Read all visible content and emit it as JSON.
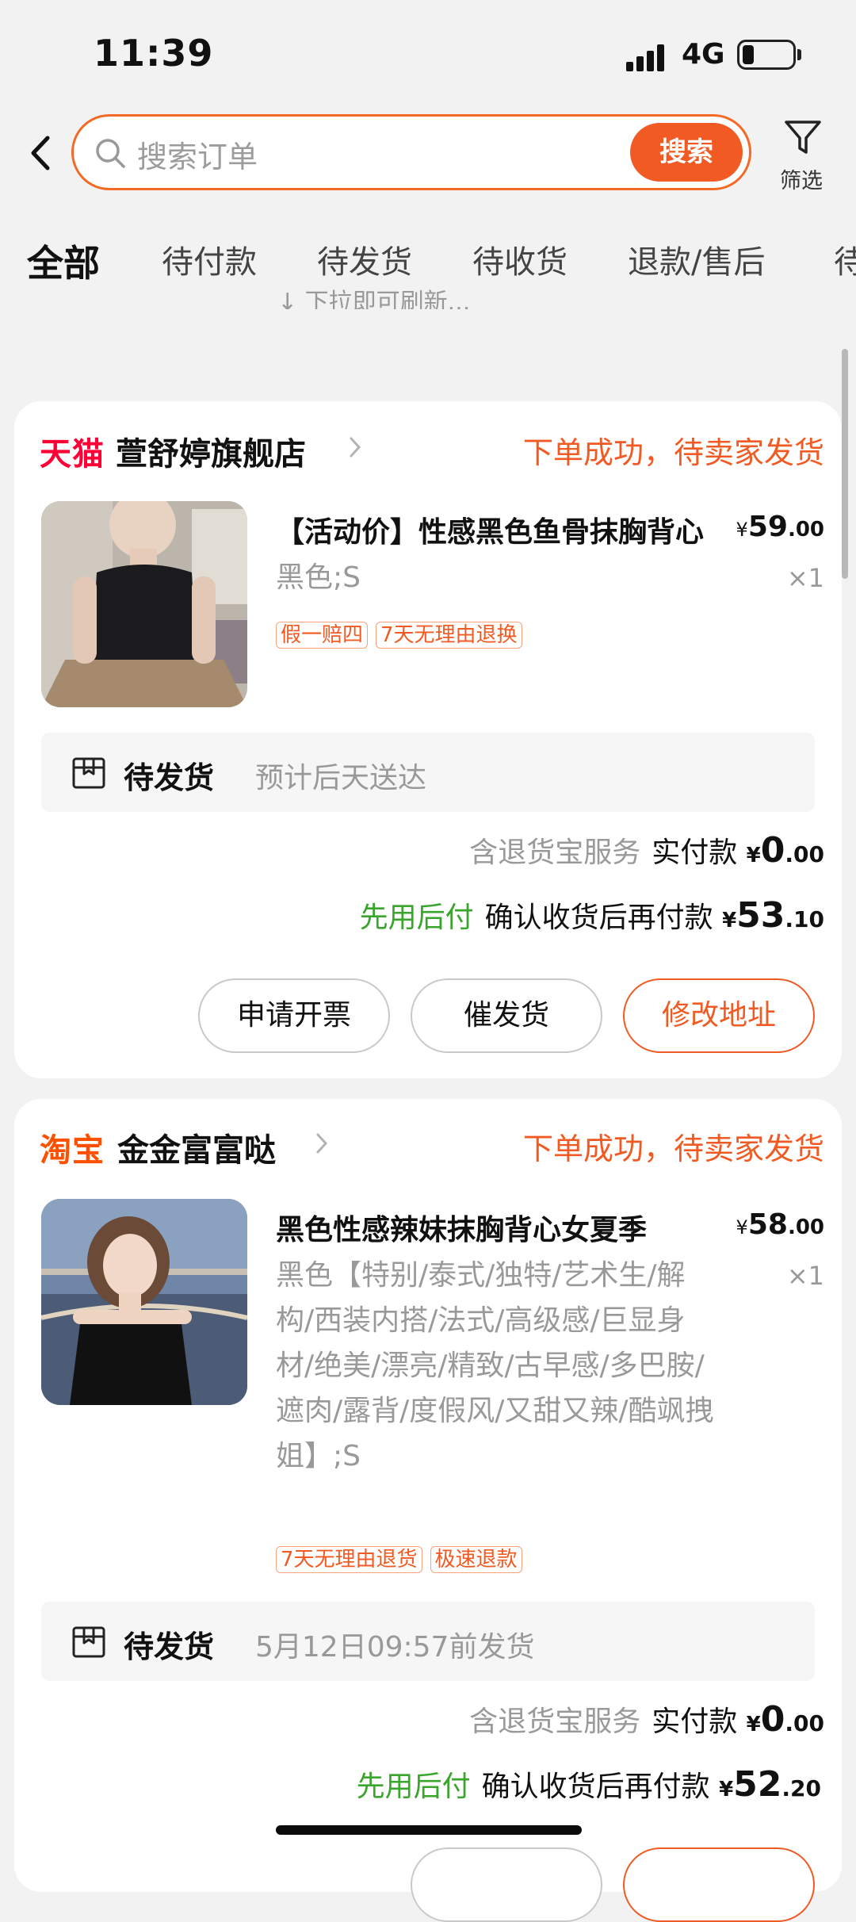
{
  "status_bar": {
    "time": "11:39",
    "network": "4G"
  },
  "header": {
    "search_placeholder": "搜索订单",
    "search_button": "搜索",
    "filter_label": "筛选"
  },
  "tabs": [
    "全部",
    "待付款",
    "待发货",
    "待收货",
    "退款/售后",
    "待"
  ],
  "refresh_hint": "↓ 下拉即可刷新...",
  "orders": [
    {
      "platform": "天猫",
      "platform_color": "#ff0036",
      "shop": "萱舒婷旗舰店",
      "status": "下单成功，待卖家发货",
      "title": "【活动价】性感黑色鱼骨抹胸背心",
      "price_symbol": "¥",
      "price_int": "59",
      "price_dec": ".00",
      "sku": "黑色;S",
      "qty": "×1",
      "tags": [
        "假一赔四",
        "7天无理由退换"
      ],
      "ship_state": "待发货",
      "ship_eta": "预计后天送达",
      "service": "含退货宝服务",
      "paid_label": "实付款",
      "paid_int": "0",
      "paid_dec": ".00",
      "later_label": "先用后付",
      "later_text": "确认收货后再付款",
      "later_int": "53",
      "later_dec": ".10",
      "buttons": [
        "申请开票",
        "催发货",
        "修改地址"
      ]
    },
    {
      "platform": "淘宝",
      "platform_color": "#ff5000",
      "shop": "金金富富哒",
      "status": "下单成功，待卖家发货",
      "title": "黑色性感辣妹抹胸背心女夏季",
      "price_symbol": "¥",
      "price_int": "58",
      "price_dec": ".00",
      "sku": "黑色【特别/泰式/独特/艺术生/解构/西装内搭/法式/高级感/巨显身材/绝美/漂亮/精致/古早感/多巴胺/遮肉/露背/度假风/又甜又辣/酷飒拽姐】;S",
      "qty": "×1",
      "tags": [
        "7天无理由退货",
        "极速退款"
      ],
      "ship_state": "待发货",
      "ship_eta": "5月12日09:57前发货",
      "service": "含退货宝服务",
      "paid_label": "实付款",
      "paid_int": "0",
      "paid_dec": ".00",
      "later_label": "先用后付",
      "later_text": "确认收货后再付款",
      "later_int": "52",
      "later_dec": ".20"
    }
  ]
}
